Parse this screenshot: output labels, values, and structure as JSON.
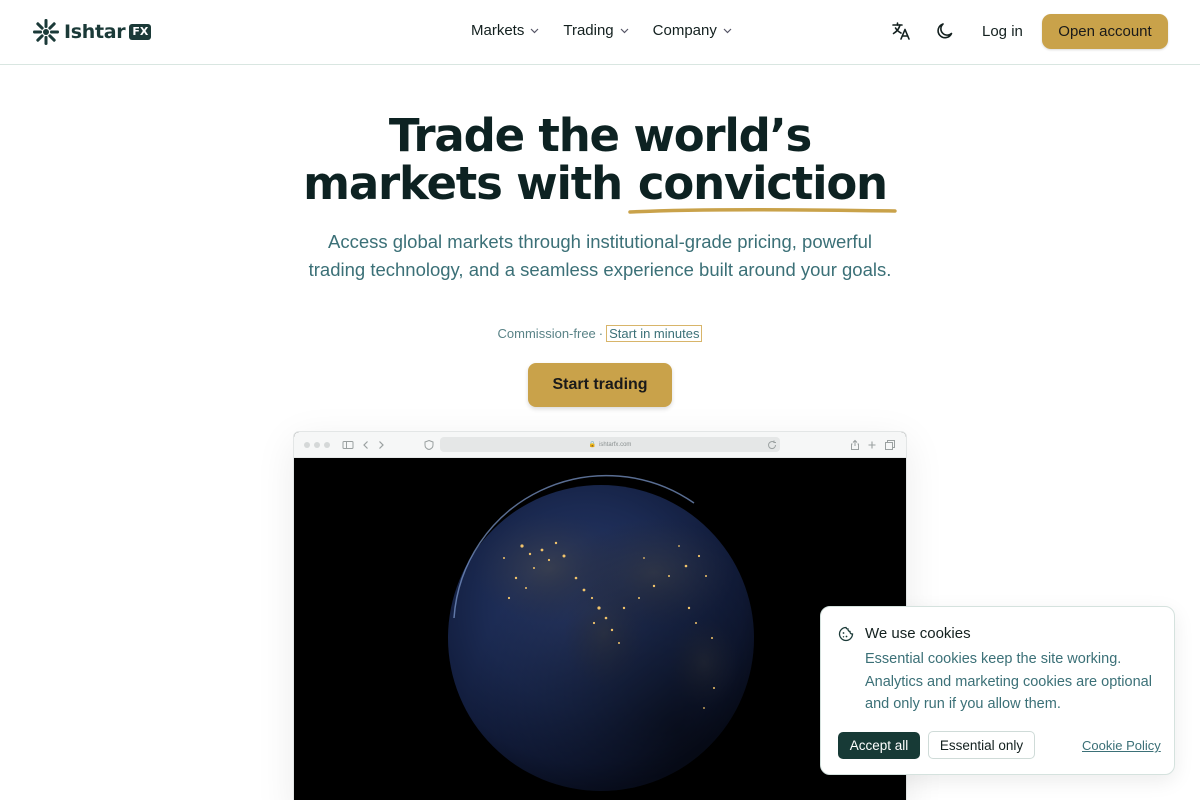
{
  "brand": {
    "name": "Ishtar",
    "badge": "FX"
  },
  "nav": {
    "items": [
      {
        "label": "Markets"
      },
      {
        "label": "Trading"
      },
      {
        "label": "Company"
      }
    ],
    "login": "Log in",
    "open_account": "Open account"
  },
  "hero": {
    "headline_line1": "Trade the world’s",
    "headline_line2_prefix": "markets with",
    "headline_highlight": "conviction",
    "subheadline": "Access global markets through institutional-grade pricing, powerful trading technology, and a seamless experience built around your goals.",
    "meta_left": "Commission-free",
    "meta_separator": "·",
    "meta_right": "Start in minutes",
    "cta": "Start trading"
  },
  "mockup": {
    "url": "ishtarfx.com"
  },
  "cookie": {
    "title": "We use cookies",
    "body": "Essential cookies keep the site working. Analytics and marketing cookies are optional and only run if you allow them.",
    "accept_all": "Accept all",
    "essential_only": "Essential only",
    "policy_link": "Cookie Policy"
  },
  "colors": {
    "accent_gold": "#c9a24a",
    "dark_teal": "#1b3a38",
    "text_teal": "#3b7077"
  }
}
